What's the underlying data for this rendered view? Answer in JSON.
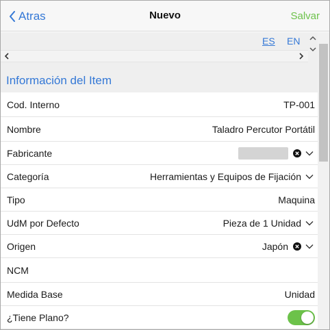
{
  "nav": {
    "back_label": "Atras",
    "title": "Nuevo",
    "save_label": "Salvar"
  },
  "languages": {
    "es": "ES",
    "en": "EN"
  },
  "section": {
    "title": "Información del Item"
  },
  "fields": {
    "cod_interno": {
      "label": "Cod. Interno",
      "value": "TP-001"
    },
    "nombre": {
      "label": "Nombre",
      "value": "Taladro Percutor Portátil"
    },
    "fabricante": {
      "label": "Fabricante",
      "value": ""
    },
    "categoria": {
      "label": "Categoría",
      "value": "Herramientas y Equipos de Fijación"
    },
    "tipo": {
      "label": "Tipo",
      "value": "Maquina"
    },
    "udm": {
      "label": "UdM por Defecto",
      "value": "Pieza de 1 Unidad"
    },
    "origen": {
      "label": "Origen",
      "value": "Japón"
    },
    "ncm": {
      "label": "NCM",
      "value": ""
    },
    "medida_base": {
      "label": "Medida Base",
      "value": "Unidad"
    },
    "tiene_plano": {
      "label": "¿Tiene Plano?",
      "checked": true
    }
  },
  "colors": {
    "accent": "#3478d6",
    "save": "#6cc24a",
    "toggle_on": "#6cc24a"
  }
}
